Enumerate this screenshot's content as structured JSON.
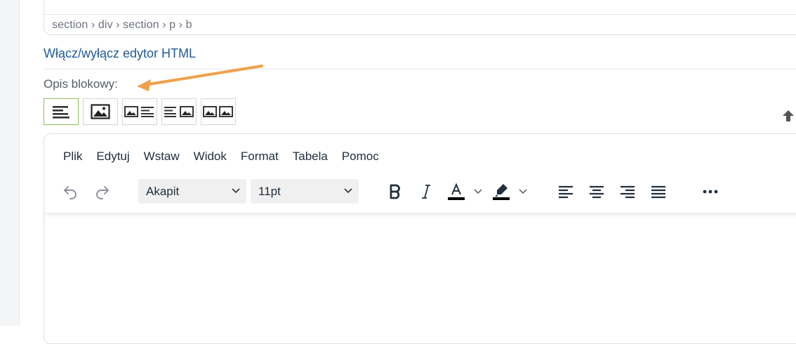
{
  "breadcrumb": {
    "path": "section › div › section › p › b"
  },
  "html_toggle": {
    "label": "Włącz/wyłącz edytor HTML"
  },
  "section": {
    "label": "Opis blokowy:"
  },
  "colors": {
    "accent_border": "#8ec25a",
    "link": "#1f5a98",
    "annotation_arrow": "#f0a04b"
  },
  "layout_options": [
    {
      "icon": "text-align-left-icon",
      "selected": true
    },
    {
      "icon": "image-icon",
      "selected": false
    },
    {
      "icon": "image-left-text-right-icon",
      "selected": false
    },
    {
      "icon": "text-left-image-right-icon",
      "selected": false
    },
    {
      "icon": "two-images-icon",
      "selected": false
    }
  ],
  "editor": {
    "menu": [
      "Plik",
      "Edytuj",
      "Wstaw",
      "Widok",
      "Format",
      "Tabela",
      "Pomoc"
    ],
    "block_format": "Akapit",
    "font_size": "11pt",
    "toolbar_icons": [
      "undo-icon",
      "redo-icon",
      "bold-icon",
      "italic-icon",
      "text-color-icon",
      "highlight-color-icon",
      "align-left-icon",
      "align-center-icon",
      "align-right-icon",
      "align-justify-icon",
      "more-icon"
    ]
  }
}
